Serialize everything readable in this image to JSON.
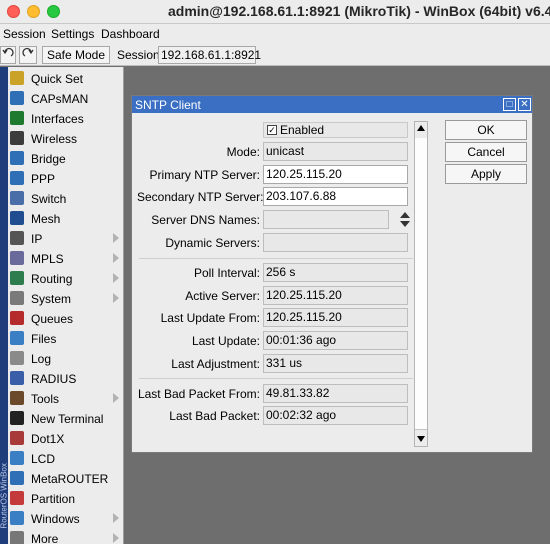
{
  "window": {
    "title": "admin@192.168.61.1:8921 (MikroTik) - WinBox (64bit) v6.4"
  },
  "menubar": {
    "items": [
      "Session",
      "Settings",
      "Dashboard"
    ]
  },
  "toolbar": {
    "safe_mode": "Safe Mode",
    "session_label": "Session:",
    "session_value": "192.168.61.1:8921"
  },
  "sidebar": {
    "brand": "RouterOS WinBox",
    "items": [
      {
        "label": "Quick Set",
        "icon": "wand-icon",
        "color": "#c9a227",
        "submenu": false
      },
      {
        "label": "CAPsMAN",
        "icon": "capsman-icon",
        "color": "#2f6fb5",
        "submenu": false
      },
      {
        "label": "Interfaces",
        "icon": "interfaces-icon",
        "color": "#1d7a2e",
        "submenu": false
      },
      {
        "label": "Wireless",
        "icon": "wireless-icon",
        "color": "#3c3c3c",
        "submenu": false
      },
      {
        "label": "Bridge",
        "icon": "bridge-icon",
        "color": "#2f6fb5",
        "submenu": false
      },
      {
        "label": "PPP",
        "icon": "ppp-icon",
        "color": "#2f6fb5",
        "submenu": false
      },
      {
        "label": "Switch",
        "icon": "switch-icon",
        "color": "#4a6ea8",
        "submenu": false
      },
      {
        "label": "Mesh",
        "icon": "mesh-icon",
        "color": "#1f4d8f",
        "submenu": false
      },
      {
        "label": "IP",
        "icon": "ip-icon",
        "color": "#555555",
        "submenu": true
      },
      {
        "label": "MPLS",
        "icon": "mpls-icon",
        "color": "#6a6a9a",
        "submenu": true
      },
      {
        "label": "Routing",
        "icon": "routing-icon",
        "color": "#2e7d4f",
        "submenu": true
      },
      {
        "label": "System",
        "icon": "gear-icon",
        "color": "#7a7a7a",
        "submenu": true
      },
      {
        "label": "Queues",
        "icon": "queues-icon",
        "color": "#b52a2a",
        "submenu": false
      },
      {
        "label": "Files",
        "icon": "folder-icon",
        "color": "#3a7fc4",
        "submenu": false
      },
      {
        "label": "Log",
        "icon": "log-icon",
        "color": "#8a8a8a",
        "submenu": false
      },
      {
        "label": "RADIUS",
        "icon": "radius-icon",
        "color": "#3a5fa8",
        "submenu": false
      },
      {
        "label": "Tools",
        "icon": "tools-icon",
        "color": "#6a4a2a",
        "submenu": true
      },
      {
        "label": "New Terminal",
        "icon": "terminal-icon",
        "color": "#222222",
        "submenu": false
      },
      {
        "label": "Dot1X",
        "icon": "dot1x-icon",
        "color": "#a83a3a",
        "submenu": false
      },
      {
        "label": "LCD",
        "icon": "lcd-icon",
        "color": "#3a7fc4",
        "submenu": false
      },
      {
        "label": "MetaROUTER",
        "icon": "metarouter-icon",
        "color": "#2f6fb5",
        "submenu": false
      },
      {
        "label": "Partition",
        "icon": "partition-icon",
        "color": "#c43a3a",
        "submenu": false
      },
      {
        "label": "Windows",
        "icon": "windows-icon",
        "color": "#3a7fc4",
        "submenu": true
      },
      {
        "label": "More",
        "icon": "more-icon",
        "color": "#777777",
        "submenu": true
      }
    ]
  },
  "dialog": {
    "title": "SNTP Client",
    "enabled_label": "Enabled",
    "enabled_checked": "✓",
    "fields": {
      "mode": {
        "label": "Mode:",
        "value": "unicast"
      },
      "primary": {
        "label": "Primary NTP Server:",
        "value": "120.25.115.20"
      },
      "secondary": {
        "label": "Secondary NTP Server:",
        "value": "203.107.6.88"
      },
      "dns_names": {
        "label": "Server DNS Names:",
        "value": ""
      },
      "dynamic": {
        "label": "Dynamic Servers:",
        "value": ""
      },
      "poll_interval": {
        "label": "Poll Interval:",
        "value": "256 s"
      },
      "active_server": {
        "label": "Active Server:",
        "value": "120.25.115.20"
      },
      "last_update_from": {
        "label": "Last Update From:",
        "value": "120.25.115.20"
      },
      "last_update": {
        "label": "Last Update:",
        "value": "00:01:36 ago"
      },
      "last_adjustment": {
        "label": "Last Adjustment:",
        "value": "331 us"
      },
      "last_bad_from": {
        "label": "Last Bad Packet From:",
        "value": "49.81.33.82"
      },
      "last_bad": {
        "label": "Last Bad Packet:",
        "value": "00:02:32 ago"
      }
    },
    "buttons": {
      "ok": "OK",
      "cancel": "Cancel",
      "apply": "Apply"
    }
  }
}
